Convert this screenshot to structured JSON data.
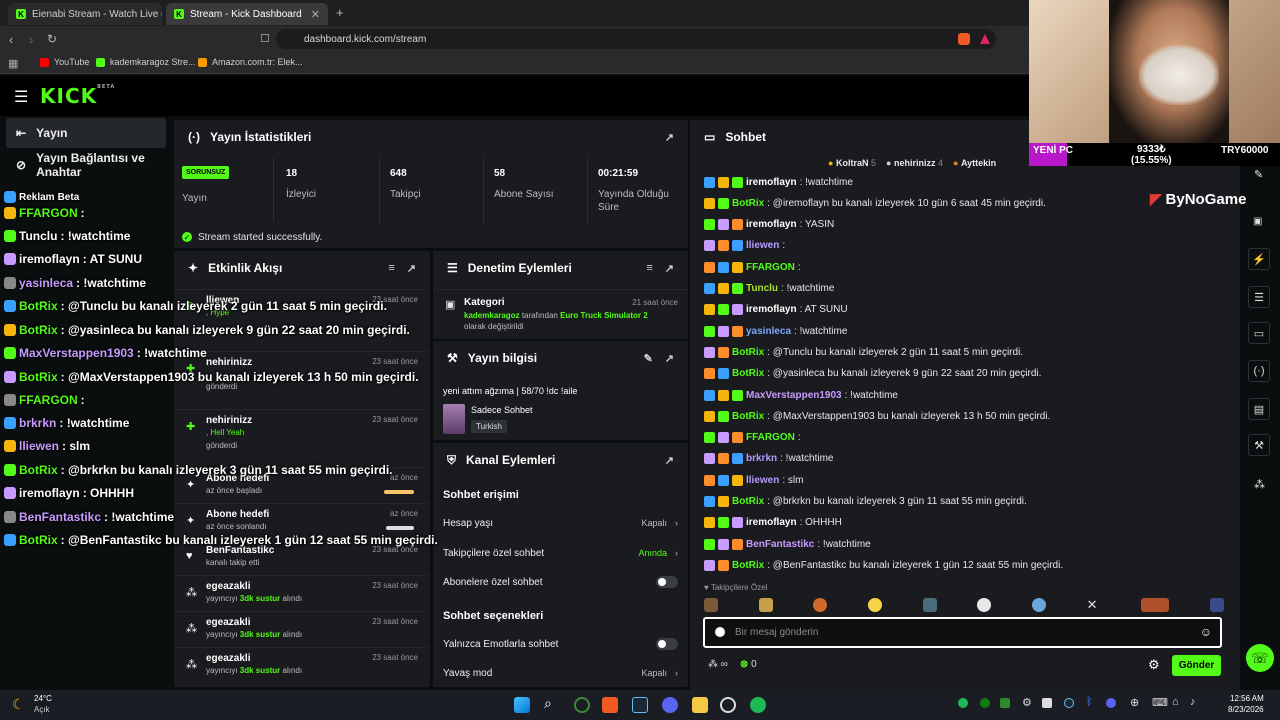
{
  "browser": {
    "tabs": [
      {
        "title": "Eienabi Stream - Watch Live on K"
      },
      {
        "title": "Stream - Kick Dashboard"
      }
    ],
    "new_tab": "+",
    "url": "dashboard.kick.com/stream",
    "bookmarks": [
      "YouTube",
      "kademkaragoz Stre...",
      "Amazon.com.tr: Elek..."
    ]
  },
  "kick": {
    "logo": "KICK",
    "logo_sup": "BETA"
  },
  "sidebar": {
    "items": [
      {
        "label": "Yayın"
      },
      {
        "label": "Yayın Bağlantısı ve Anahtar"
      }
    ]
  },
  "stats_panel": {
    "title": "Yayın İstatistikleri",
    "status_badge": "SORUNSUZ",
    "status_label": "Yayın",
    "stats": [
      {
        "value": "18",
        "label": "İzleyici"
      },
      {
        "value": "648",
        "label": "Takipçi"
      },
      {
        "value": "58",
        "label": "Abone Sayısı"
      },
      {
        "value": "00:21:59",
        "label": "Yayında Olduğu Süre"
      }
    ],
    "success_msg": "Stream started successfully."
  },
  "activity": {
    "title": "Etkinlik Akışı",
    "events": [
      {
        "name": "lliewen",
        "sub": ", Hype",
        "sub2": "gönderdi",
        "time": "23 saat önce"
      },
      {
        "name": "nehirinizz",
        "sub": "",
        "sub2": "gönderdi",
        "time": "23 saat önce"
      },
      {
        "name": "nehirinizz",
        "sub": ", Hell Yeah",
        "sub2": "gönderdi",
        "time": "23 saat önce"
      },
      {
        "name": "Abone hedefi",
        "sub": "az önce başladı",
        "time": "az önce"
      },
      {
        "name": "Abone hedefi",
        "sub": "az önce sonlandı",
        "time": "az önce"
      },
      {
        "name": "BenFantastikc",
        "sub": "kanalı takip etti",
        "time": "23 saat önce"
      },
      {
        "name": "egeazakli",
        "sub_pre": "yayıncıyı ",
        "sub_hl": "3dk sustur",
        "sub_post": " alındı",
        "time": "23 saat önce"
      },
      {
        "name": "egeazakli",
        "sub_pre": "yayıncıyı ",
        "sub_hl": "3dk sustur",
        "sub_post": " alındı",
        "time": "23 saat önce"
      },
      {
        "name": "egeazakli",
        "sub_pre": "yayıncıyı ",
        "sub_hl": "3dk sustur",
        "sub_post": " alındı",
        "time": "23 saat önce"
      }
    ]
  },
  "moderation": {
    "title": "Denetim Eylemleri",
    "item_title": "Kategori",
    "item_time": "21 saat önce",
    "item_user": "kademkaragoz",
    "item_mid": " tarafından ",
    "item_target": "Euro Truck Simulator 2",
    "item_end": "olarak değiştirildi"
  },
  "stream_info": {
    "title": "Yayın bilgisi",
    "stream_title": "yeni attım ağzıma | 58/70 !dc !aile",
    "category": "Sadece Sohbet",
    "tag": "Turkish"
  },
  "channel_actions": {
    "title": "Kanal Eylemleri",
    "section1": "Sohbet erişimi",
    "rows1": [
      {
        "label": "Hesap yaşı",
        "value": "Kapalı"
      },
      {
        "label": "Takipçilere özel sohbet",
        "value": "Anında"
      },
      {
        "label": "Abonelere özel sohbet",
        "value": ""
      }
    ],
    "section2": "Sohbet seçenekleri",
    "rows2": [
      {
        "label": "Yalnızca Emotlarla sohbet",
        "value": ""
      },
      {
        "label": "Yavaş mod",
        "value": "Kapalı"
      }
    ]
  },
  "chat": {
    "title": "Sohbet",
    "pinned": [
      {
        "name": "KoltraN",
        "count": "5"
      },
      {
        "name": "nehirinizz",
        "count": "4"
      },
      {
        "name": "Ayttekin",
        "count": "3"
      }
    ],
    "messages": [
      {
        "user": "iremoflayn",
        "color": "#ffffff",
        "text": ": !watchtime"
      },
      {
        "user": "BotRix",
        "color": "#53fc18",
        "text": ": @iremoflayn bu kanalı izleyerek 10 gün 6 saat 45 min geçirdi."
      },
      {
        "user": "iremoflayn",
        "color": "#ffffff",
        "text": ": YASIN"
      },
      {
        "user": "lliewen",
        "color": "#b69cff",
        "text": ": "
      },
      {
        "user": "FFARGON",
        "color": "#53fc18",
        "text": ": "
      },
      {
        "user": "Tunclu",
        "color": "#a6e22e",
        "text": ": !watchtime"
      },
      {
        "user": "iremoflayn",
        "color": "#ffffff",
        "text": ": AT SUNU"
      },
      {
        "user": "yasinleca",
        "color": "#7aa7ff",
        "text": ": !watchtime"
      },
      {
        "user": "BotRix",
        "color": "#53fc18",
        "text": ": @Tunclu bu kanalı izleyerek 2 gün 11 saat 5 min geçirdi."
      },
      {
        "user": "BotRix",
        "color": "#53fc18",
        "text": ": @yasinleca bu kanalı izleyerek 9 gün 22 saat 20 min geçirdi."
      },
      {
        "user": "MaxVerstappen1903",
        "color": "#c99bff",
        "text": ": !watchtime"
      },
      {
        "user": "BotRix",
        "color": "#53fc18",
        "text": ": @MaxVerstappen1903 bu kanalı izleyerek 13 h 50 min geçirdi."
      },
      {
        "user": "FFARGON",
        "color": "#53fc18",
        "text": ": "
      },
      {
        "user": "brkrkn",
        "color": "#b69cff",
        "text": ": !watchtime"
      },
      {
        "user": "lliewen",
        "color": "#b69cff",
        "text": ": slm"
      },
      {
        "user": "BotRix",
        "color": "#53fc18",
        "text": ": @brkrkn bu kanalı izleyerek 3 gün 11 saat 55 min geçirdi."
      },
      {
        "user": "iremoflayn",
        "color": "#ffffff",
        "text": ": OHHHH"
      },
      {
        "user": "BenFantastikc",
        "color": "#c99bff",
        "text": ": !watchtime"
      },
      {
        "user": "BotRix",
        "color": "#53fc18",
        "text": ": @BenFantastikc bu kanalı izleyerek 1 gün 12 saat 55 min geçirdi."
      }
    ],
    "followers_only": "Takipçilere Özel",
    "input_placeholder": "Bir mesaj gönderin",
    "points": "0",
    "send": "Gönder"
  },
  "overlay": {
    "lines": [
      {
        "user": "Reklam",
        "text": " Beta"
      },
      {
        "user": "FFARGON",
        "text": " :"
      },
      {
        "user": "Tunclu",
        "text": " : !watchtime"
      },
      {
        "user": "iremoflayn",
        "text": " : AT SUNU"
      },
      {
        "user": "yasinleca",
        "text": " : !watchtime"
      },
      {
        "user": "BotRix",
        "text": " : @Tunclu bu kanalı izleyerek 2 gün 11 saat 5 min geçirdi."
      },
      {
        "user": "BotRix",
        "text": " : @yasinleca bu kanalı izleyerek 9 gün 22 saat 20 min geçirdi."
      },
      {
        "user": "MaxVerstappen1903",
        "text": " : !watchtime"
      },
      {
        "user": "BotRix",
        "text": " : @MaxVerstappen1903 bu kanalı izleyerek 13 h 50 min geçirdi."
      },
      {
        "user": "FFARGON",
        "text": " :"
      },
      {
        "user": "brkrkn",
        "text": " : !watchtime"
      },
      {
        "user": "lliewen",
        "text": " : slm"
      },
      {
        "user": "BotRix",
        "text": " : @brkrkn bu kanalı izleyerek 3 gün 11 saat 55 min geçirdi."
      },
      {
        "user": "iremoflayn",
        "text": " : OHHHH"
      },
      {
        "user": "BenFantastikc",
        "text": " : !watchtime"
      },
      {
        "user": "BotRix",
        "text": " : @BenFantastikc bu kanalı izleyerek 1 gün 12 saat 55 min geçirdi."
      }
    ],
    "brand": "ByNoGame"
  },
  "webcam": {
    "label": "YENİ PC",
    "amount": "9333₺",
    "percent": "(15.55%)",
    "goal": "TRY60000"
  },
  "taskbar": {
    "weather_temp": "24°C",
    "weather_desc": "Açık",
    "time": "12:56 AM",
    "date": "8/23/2026"
  },
  "colors": {
    "brand": "#53fc18",
    "panel": "#191b1f",
    "bg": "#0b0e0f"
  }
}
